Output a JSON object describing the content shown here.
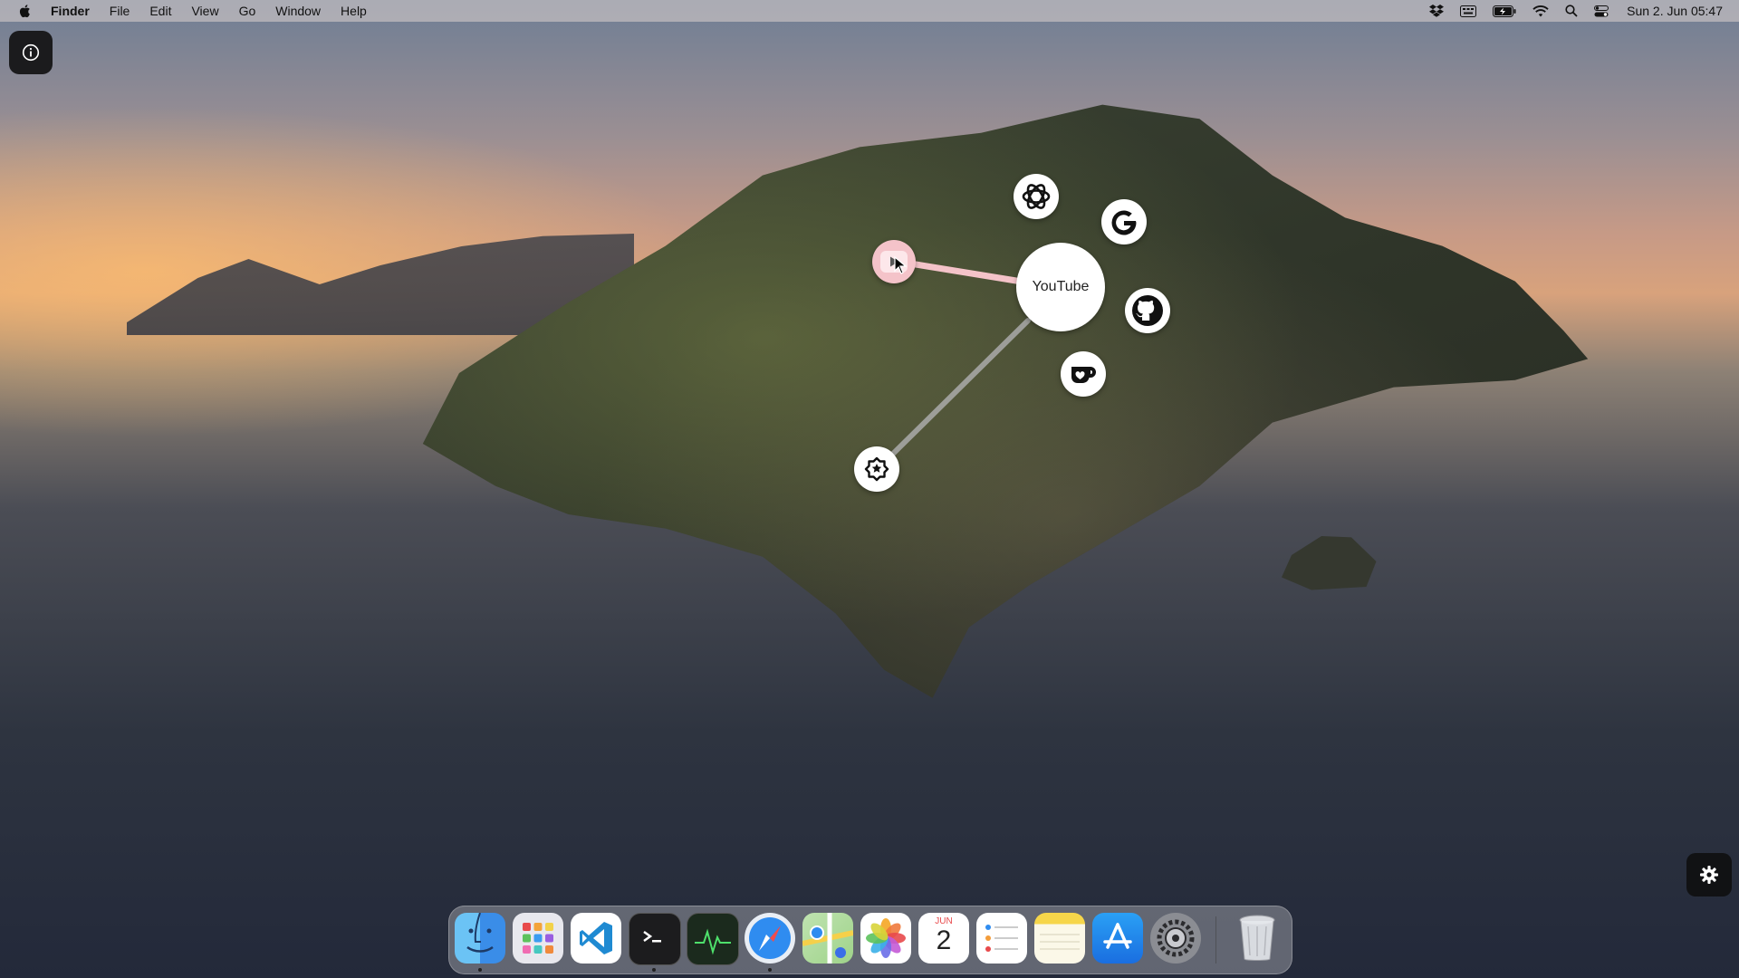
{
  "menubar": {
    "apple_icon": "apple-logo",
    "items": [
      "Finder",
      "File",
      "Edit",
      "View",
      "Go",
      "Window",
      "Help"
    ],
    "status_icons": [
      "dropbox-icon",
      "keyboard-input-icon",
      "battery-charging-icon",
      "wifi-icon",
      "search-icon",
      "control-center-icon"
    ],
    "clock": "Sun 2. Jun  05:47"
  },
  "launcher": {
    "hub_label": "YouTube",
    "nodes": [
      "chatgpt-icon",
      "google-icon",
      "github-icon",
      "kofi-icon",
      "picker-icon",
      "youtube-active-icon"
    ]
  },
  "dock": {
    "apps": [
      "Finder",
      "Launchpad",
      "Visual Studio Code",
      "Terminal",
      "Activity Monitor",
      "Safari",
      "Maps",
      "Photos",
      "Calendar",
      "Reminders",
      "Notes",
      "App Store",
      "System Settings",
      "Trash"
    ],
    "calendar_month": "JUN",
    "calendar_day": "2"
  },
  "colors": {
    "accent_pink": "#f4c3c9",
    "menubar_bg": "#dcd2cd"
  }
}
